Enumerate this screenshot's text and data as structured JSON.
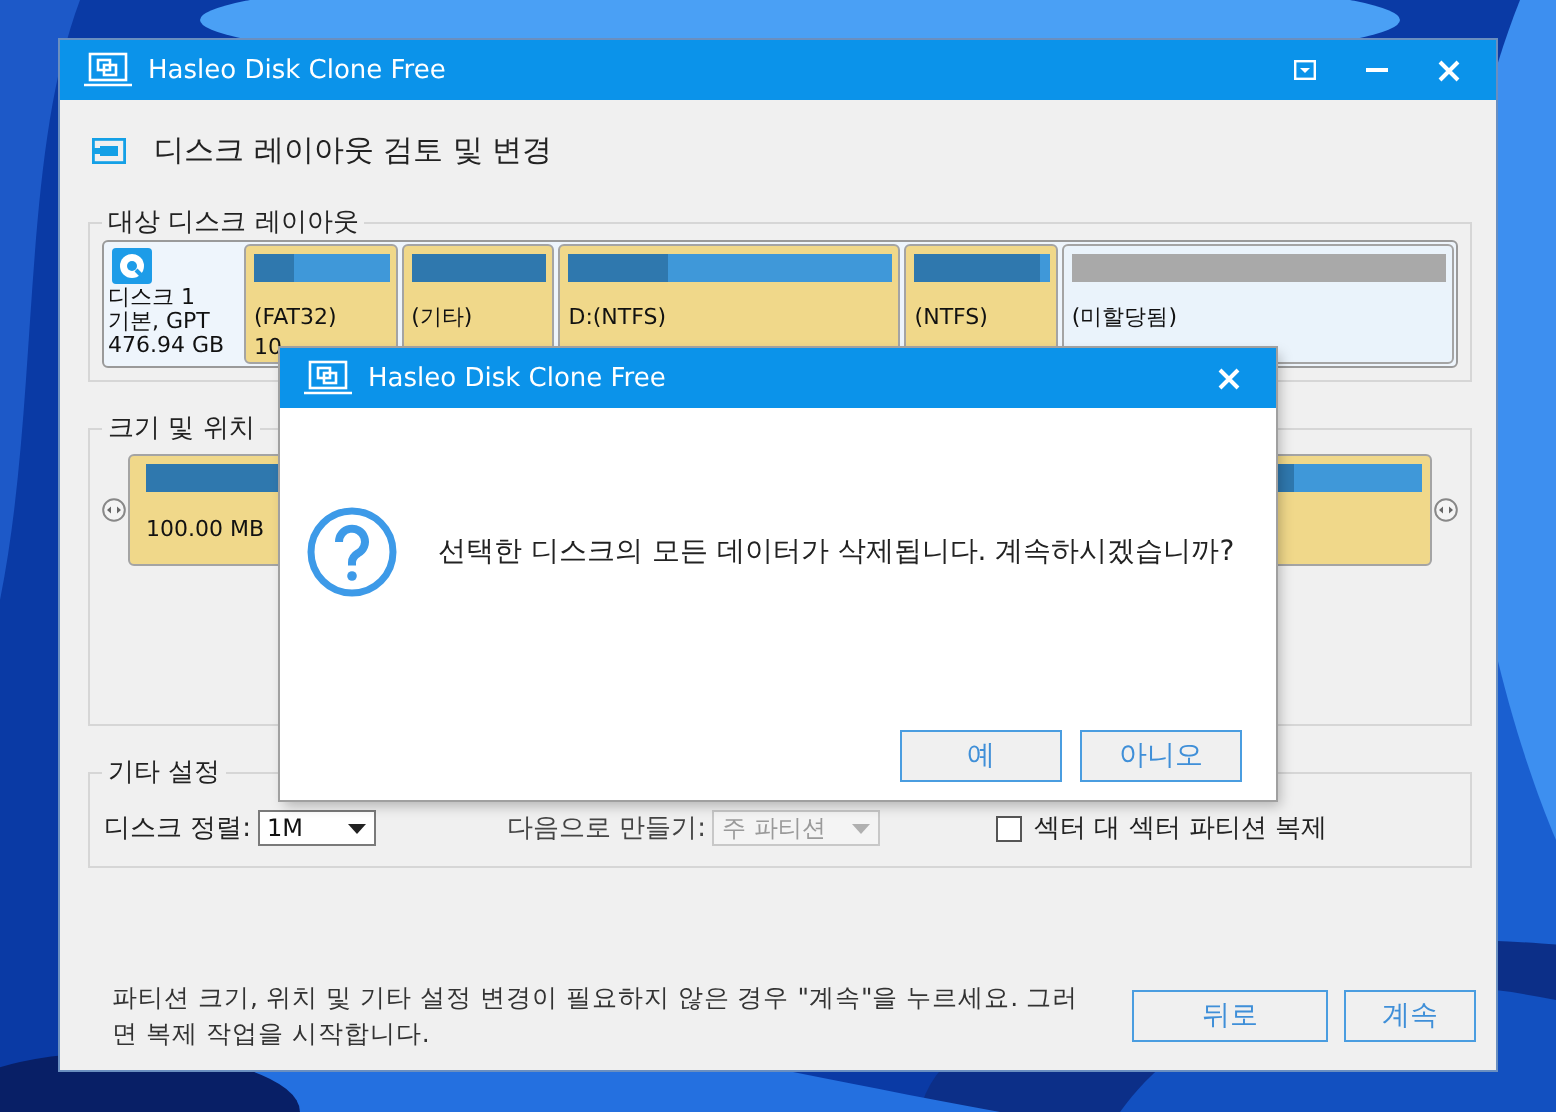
{
  "window": {
    "title": "Hasleo Disk Clone Free"
  },
  "header": {
    "title": "디스크 레이아웃 검토 및 변경"
  },
  "layout_group": {
    "title": "대상 디스크 레이아웃",
    "disk": {
      "name": "디스크 1",
      "type": "기본, GPT",
      "size": "476.94 GB"
    },
    "partitions": [
      {
        "kind": "partition",
        "label": "(FAT32)",
        "size": "10",
        "level": 0.3
      },
      {
        "kind": "partition",
        "label": "(기타)",
        "level": 1
      },
      {
        "kind": "partition",
        "label": "D:(NTFS)",
        "level": 0.31
      },
      {
        "kind": "partition",
        "label": "(NTFS)",
        "level": 0.93
      },
      {
        "kind": "unallocated",
        "label": "(미할당됨)"
      }
    ]
  },
  "resize_group": {
    "title": "크기 및 위치",
    "partition": {
      "size": "100.00 MB",
      "level": 0.9
    }
  },
  "other_settings": {
    "title": "기타 설정",
    "alignment": {
      "label": "디스크 정렬:",
      "value": "1M"
    },
    "create_as": {
      "label": "다음으로 만들기:",
      "value": "주 파티션",
      "disabled": true
    },
    "sector_clone": {
      "label": "섹터 대 섹터 파티션 복제",
      "checked": false
    }
  },
  "footer": {
    "message": "파티션 크기, 위치 및 기타 설정 변경이 필요하지 않은 경우 \"계속\"을 누르세요. 그러면 복제 작업을 시작합니다.",
    "buttons": [
      {
        "label": "뒤로"
      },
      {
        "label": "계속"
      }
    ]
  },
  "dialog": {
    "title": "Hasleo Disk Clone Free",
    "message": "선택한 디스크의 모든 데이터가 삭제됩니다. 계속하시겠습니까?",
    "buttons": [
      {
        "label": "예"
      },
      {
        "label": "아니오"
      }
    ]
  }
}
